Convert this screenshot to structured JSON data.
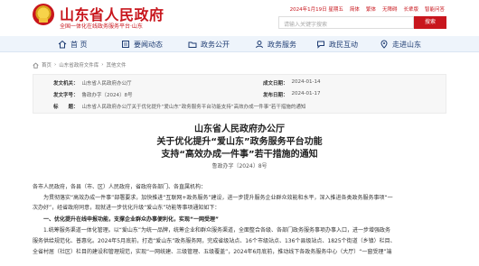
{
  "header": {
    "site_title": "山东省人民政府",
    "site_subtitle": "全国一体化在线政务服务平台·山东",
    "topbar": [
      "2024年1月19日 星期五",
      "简体",
      "繁体",
      "无障碍",
      "长辈版",
      "智能问答"
    ],
    "search_placeholder": "请输入关键字搜索",
    "search_button": "搜索",
    "brand_color": "#c8161d"
  },
  "nav": {
    "items": [
      {
        "label": "首 页",
        "icon": "home-icon"
      },
      {
        "label": "要闻动态",
        "icon": "news-icon"
      },
      {
        "label": "政务公开",
        "icon": "folder-icon"
      },
      {
        "label": "政务服务",
        "icon": "service-icon"
      },
      {
        "label": "政民互动",
        "icon": "chat-icon"
      },
      {
        "label": "走进山东",
        "icon": "location-icon"
      }
    ]
  },
  "breadcrumb": [
    "首页",
    "山东省政府文件库",
    "其他文件"
  ],
  "meta": {
    "issuer_label": "发文机关：",
    "issuer": "山东省人民政府办公厅",
    "docno_label": "发文字号：",
    "docno": "鲁政办字〔2024〕8号",
    "date_label": "成文日期：",
    "date": "2024-01-14",
    "publish_label": "发布日期：",
    "publish": "2024-01-17",
    "title_label": "标　　题：",
    "title": "山东省人民政府办公厅关于优化提升“爱山东”政务服务平台功能支持“高效办成一件事”若干措施的通知"
  },
  "document": {
    "title_line1": "山东省人民政府办公厅",
    "title_line2": "关于优化提升“爱山东”政务服务平台功能",
    "title_line3": "支持“高效办成一件事”若干措施的通知",
    "docno": "鲁政办字〔2024〕8号",
    "salutation": "各市人民政府，各县（市、区）人民政府，省政府各部门、各直属机构：",
    "para1_line1": "为贯彻落实“高效办成一件事”部署要求，加快推进“互联网+政务服务”建设，进一步提升服务企业群众效能和水平，深入推进各类政务服务事项“一",
    "para1_line2": "次办好”，经省政府同意，现就进一步优化升级“爱山东”功能等事项通知如下：",
    "section1": "一、优化提升在线申报功能，支撑企业群众办事便利化，实现“一网受理”",
    "para2_line1": "1.统筹服务渠道一体化管理。以“爱山东”为统一品牌，统筹企业和群众服务渠道，全面整合各级、各部门政务服务事项办事入口，进一步增强政务",
    "para2_line2": "服务供给规范化、普惠化。2024年5月底前，打造“爱山东”政务服务网，完成省级站点、16个市级站点、136个县级站点、1825个街道（乡镇）栏目、",
    "para2_line3": "全省村居（社区）栏目的建设和管理规范，实现“一网统建、三级管理、五级覆盖”，2024年6月底前，推动线下各政务服务中心（大厅）“一窗受理”端"
  }
}
